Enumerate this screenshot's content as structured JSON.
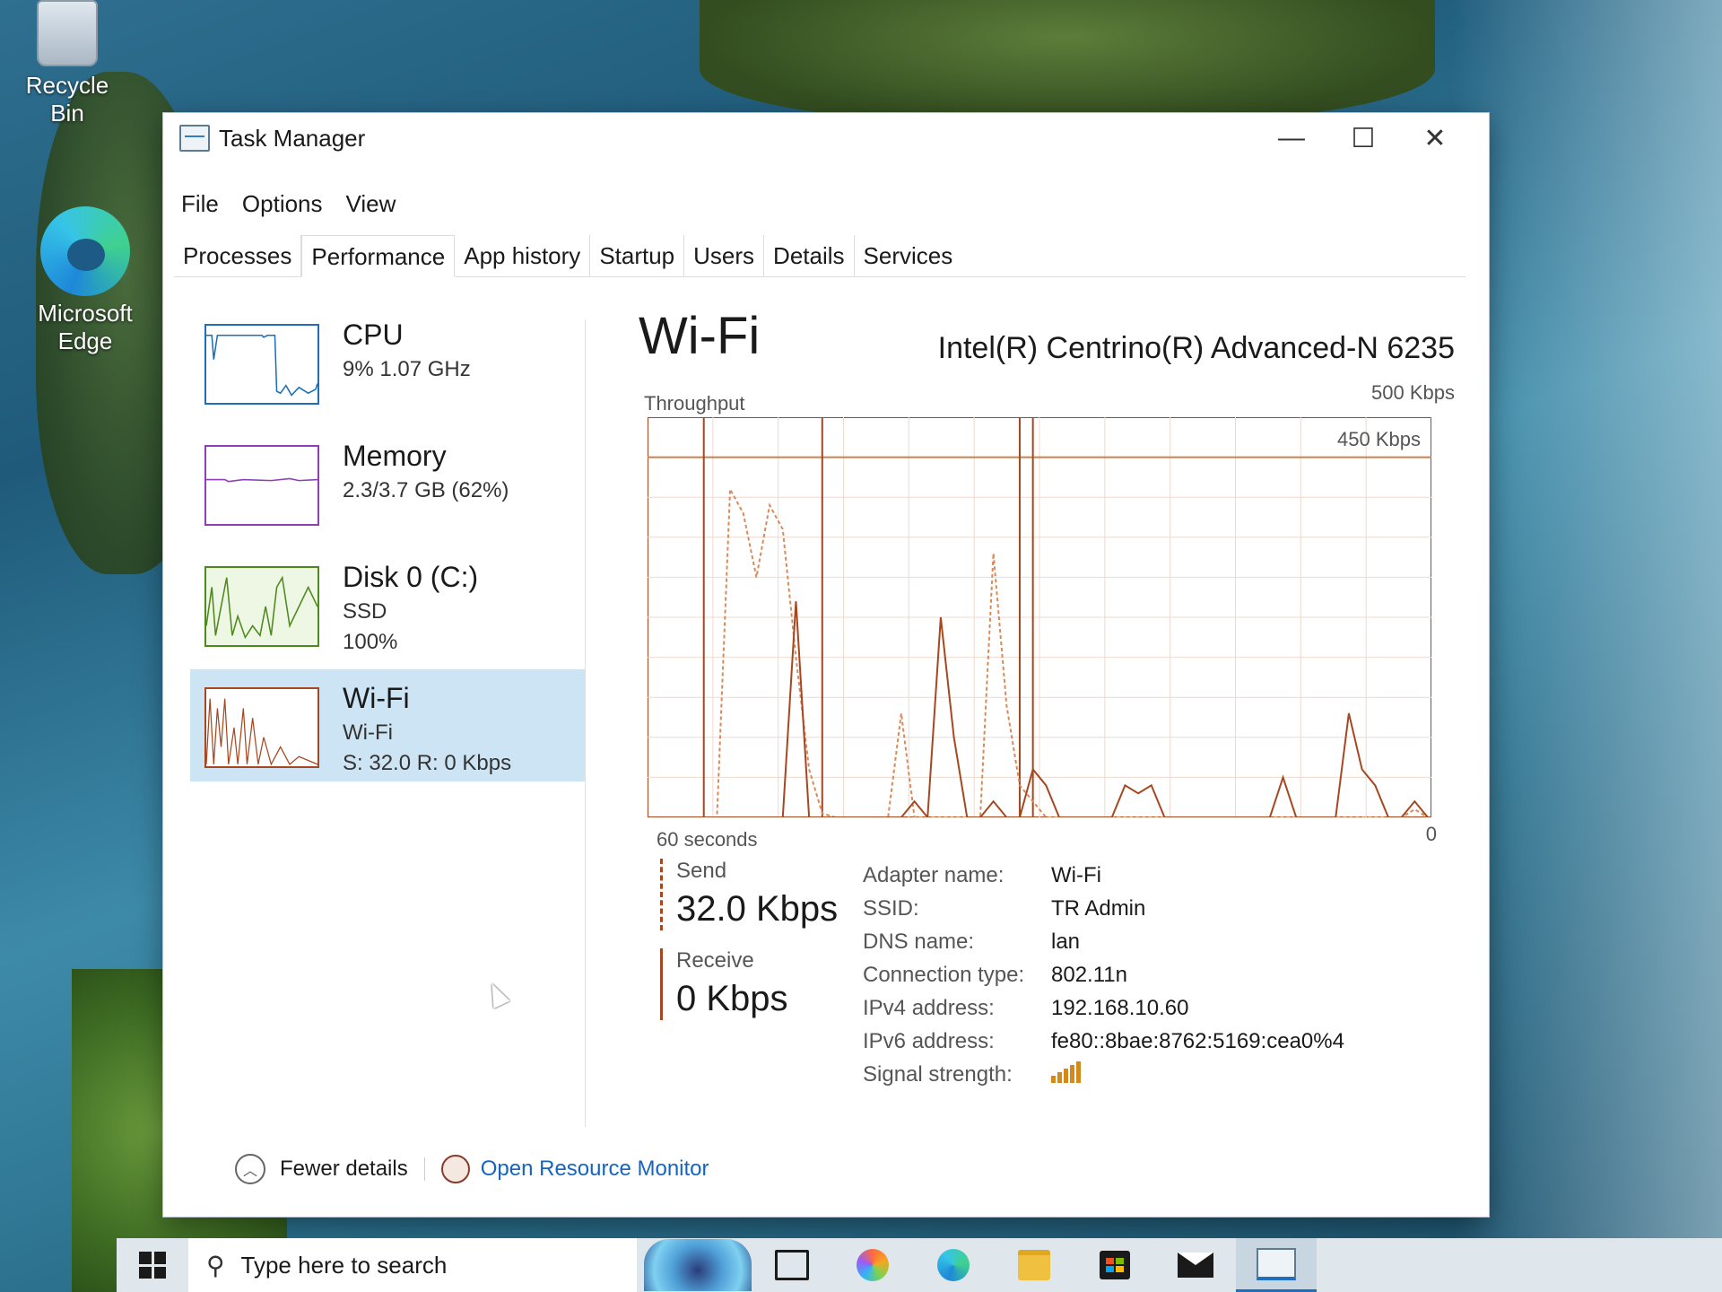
{
  "desktop": {
    "icons": [
      {
        "label": "Recycle Bin",
        "icon": "recycle-bin-icon"
      },
      {
        "label": "Microsoft Edge",
        "icon": "edge-icon"
      }
    ]
  },
  "window": {
    "title": "Task Manager",
    "controls": {
      "minimize": "—",
      "maximize": "☐",
      "close": "✕"
    },
    "menu": [
      "File",
      "Options",
      "View"
    ],
    "tabs": [
      "Processes",
      "Performance",
      "App history",
      "Startup",
      "Users",
      "Details",
      "Services"
    ],
    "active_tab": "Performance"
  },
  "sidebar": {
    "items": [
      {
        "title": "CPU",
        "line1": "9%  1.07 GHz",
        "line2": "",
        "color": "#1d70b8"
      },
      {
        "title": "Memory",
        "line1": "2.3/3.7 GB (62%)",
        "line2": "",
        "color": "#8e3fb8"
      },
      {
        "title": "Disk 0 (C:)",
        "line1": "SSD",
        "line2": "100%",
        "color": "#4d8a1e"
      },
      {
        "title": "Wi-Fi",
        "line1": "Wi-Fi",
        "line2": "S: 32.0  R: 0 Kbps",
        "color": "#a7471f",
        "selected": true
      }
    ]
  },
  "main": {
    "title": "Wi-Fi",
    "adapter": "Intel(R) Centrino(R) Advanced-N 6235",
    "graph_label": "Throughput",
    "max_label": "500 Kbps",
    "line_label": "450 Kbps",
    "time_label": "60 seconds",
    "zero_label": "0",
    "send": {
      "label": "Send",
      "value": "32.0 Kbps"
    },
    "receive": {
      "label": "Receive",
      "value": "0 Kbps"
    },
    "props": [
      {
        "key": "Adapter name:",
        "value": "Wi-Fi"
      },
      {
        "key": "SSID:",
        "value": "TR Admin"
      },
      {
        "key": "DNS name:",
        "value": "lan"
      },
      {
        "key": "Connection type:",
        "value": "802.11n"
      },
      {
        "key": "IPv4 address:",
        "value": "192.168.10.60"
      },
      {
        "key": "IPv6 address:",
        "value": "fe80::8bae:8762:5169:cea0%4"
      },
      {
        "key": "Signal strength:",
        "value": ""
      }
    ],
    "signal_bars": 5
  },
  "footer": {
    "fewer_details": "Fewer details",
    "resource_monitor": "Open Resource Monitor"
  },
  "taskbar": {
    "search_placeholder": "Type here to search"
  },
  "chart_data": {
    "type": "line",
    "ylim": [
      0,
      500
    ],
    "series": [
      {
        "values": [
          0,
          0,
          0,
          0,
          0,
          0,
          410,
          380,
          300,
          390,
          360,
          200,
          60,
          5,
          0,
          0,
          0,
          0,
          0,
          130,
          0,
          0,
          0,
          0,
          0,
          0,
          330,
          140,
          40,
          20,
          0,
          0,
          0,
          0,
          0,
          0,
          0,
          0,
          0,
          0,
          0,
          0,
          0,
          0,
          0,
          0,
          0,
          0,
          0,
          0,
          0,
          0,
          0,
          0,
          0,
          0,
          0,
          0,
          10,
          0
        ]
      },
      {
        "values": [
          0,
          0,
          0,
          0,
          0,
          0,
          0,
          0,
          0,
          0,
          0,
          270,
          0,
          0,
          0,
          0,
          0,
          0,
          0,
          0,
          20,
          0,
          250,
          100,
          0,
          0,
          20,
          0,
          0,
          60,
          40,
          0,
          0,
          0,
          0,
          0,
          40,
          30,
          40,
          0,
          0,
          0,
          0,
          0,
          0,
          0,
          0,
          0,
          50,
          0,
          0,
          0,
          0,
          130,
          60,
          40,
          0,
          0,
          20,
          0
        ]
      }
    ],
    "spikes": [
      {
        "x": 4,
        "value": 500
      },
      {
        "x": 13,
        "value": 500
      },
      {
        "x": 28,
        "value": 500
      },
      {
        "x": 29,
        "value": 500
      }
    ],
    "reference_line": 450,
    "grid": true
  }
}
